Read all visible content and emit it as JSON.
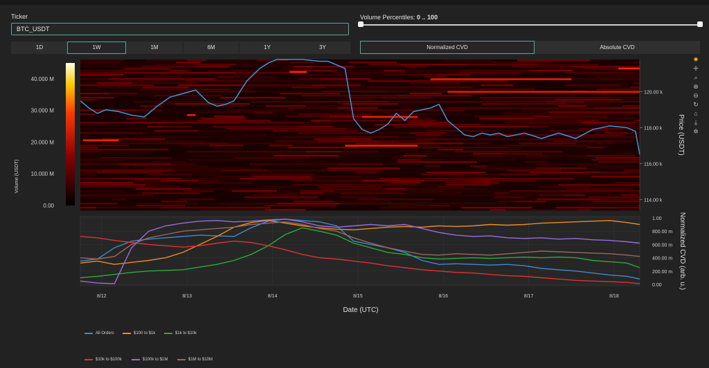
{
  "controls": {
    "ticker_label": "Ticker",
    "ticker_value": "BTC_USDT",
    "percentiles_label": "Volume Percentiles: ",
    "percentiles_value": "0 .. 100",
    "ranges": [
      {
        "label": "1D",
        "active": false
      },
      {
        "label": "1W",
        "active": true
      },
      {
        "label": "1M",
        "active": false
      },
      {
        "label": "6M",
        "active": false
      },
      {
        "label": "1Y",
        "active": false
      },
      {
        "label": "3Y",
        "active": false
      }
    ],
    "cvd_modes": [
      {
        "label": "Normalized CVD",
        "active": true
      },
      {
        "label": "Absolute CVD",
        "active": false
      }
    ]
  },
  "modebar_icons": [
    "plotly-logo-icon",
    "pan-icon",
    "zoom-icon",
    "zoom-in-icon",
    "zoom-out-icon",
    "autoscale-icon",
    "reset-icon",
    "download-icon",
    "spike-icon"
  ],
  "chart_data": [
    {
      "type": "heatmap",
      "title": "",
      "colorbar_title": "Volume (USDT)",
      "colorbar_ticks": [
        {
          "v": 0,
          "label": "0.00"
        },
        {
          "v": 10000000,
          "label": "10.000 M"
        },
        {
          "v": 20000000,
          "label": "20.000 M"
        },
        {
          "v": 30000000,
          "label": "30.000 M"
        },
        {
          "v": 40000000,
          "label": "40.000 M"
        }
      ],
      "colorbar_range": [
        0,
        45000000
      ],
      "ylabel": "Price (USDT)",
      "ylim": [
        113400,
        121800
      ],
      "yticks": [
        {
          "v": 114000,
          "label": "114.00 k"
        },
        {
          "v": 116000,
          "label": "116.00 k"
        },
        {
          "v": 118000,
          "label": "118.00 k"
        },
        {
          "v": 120000,
          "label": "120.00 k"
        }
      ],
      "xlim": [
        0,
        6.55
      ],
      "price_series": {
        "name": "Price",
        "color": "#3f8fd2",
        "x": [
          0,
          0.1,
          0.2,
          0.3,
          0.45,
          0.6,
          0.75,
          0.9,
          1.05,
          1.2,
          1.35,
          1.5,
          1.6,
          1.7,
          1.8,
          1.95,
          2.1,
          2.2,
          2.3,
          2.45,
          2.6,
          2.8,
          2.9,
          3.0,
          3.1,
          3.2,
          3.3,
          3.4,
          3.5,
          3.6,
          3.7,
          3.8,
          3.9,
          4.0,
          4.1,
          4.2,
          4.3,
          4.4,
          4.5,
          4.6,
          4.7,
          4.8,
          4.9,
          5.0,
          5.2,
          5.4,
          5.6,
          5.8,
          6.0,
          6.2,
          6.4,
          6.5,
          6.55
        ],
        "y": [
          119500,
          119100,
          118800,
          119000,
          118900,
          118700,
          118600,
          119200,
          119700,
          119900,
          120100,
          119400,
          119200,
          119300,
          119500,
          120600,
          121300,
          121600,
          121900,
          121800,
          121800,
          121700,
          121700,
          121500,
          121300,
          118500,
          117900,
          117700,
          117900,
          118200,
          118800,
          118400,
          118900,
          119000,
          119100,
          119300,
          118400,
          118000,
          117600,
          117500,
          117700,
          117600,
          117700,
          117500,
          117700,
          117400,
          117700,
          117400,
          117900,
          118100,
          118000,
          117800,
          116500
        ]
      },
      "bands": [
        {
          "y": 121300,
          "x0": 6.3,
          "x1": 6.55,
          "c": 0.9
        },
        {
          "y": 121100,
          "x0": 2.45,
          "x1": 2.65,
          "c": 0.95
        },
        {
          "y": 120700,
          "x0": 4.1,
          "x1": 5.75,
          "c": 0.75
        },
        {
          "y": 120000,
          "x0": 4.3,
          "x1": 6.55,
          "c": 0.7
        },
        {
          "y": 118700,
          "x0": 1.25,
          "x1": 1.35,
          "c": 0.8
        },
        {
          "y": 118600,
          "x0": 3.3,
          "x1": 3.95,
          "c": 0.75
        },
        {
          "y": 117300,
          "x0": 0.03,
          "x1": 0.45,
          "c": 0.85
        },
        {
          "y": 117000,
          "x0": 3.1,
          "x1": 3.95,
          "c": 0.85
        }
      ]
    },
    {
      "type": "line",
      "title": "",
      "xlabel": "Date (UTC)",
      "ylabel": "Normalized CVD (arb. u.)",
      "ylim": [
        -0.02,
        1.02
      ],
      "yticks": [
        {
          "v": 0,
          "label": "0.00"
        },
        {
          "v": 0.2,
          "label": "200.00 m"
        },
        {
          "v": 0.4,
          "label": "400.00 m"
        },
        {
          "v": 0.6,
          "label": "600.00 m"
        },
        {
          "v": 0.8,
          "label": "800.00 m"
        },
        {
          "v": 1,
          "label": "1.00"
        }
      ],
      "xlim": [
        0,
        6.55
      ],
      "xticks": [
        {
          "v": 0.25,
          "label": "8/12"
        },
        {
          "v": 1.25,
          "label": "8/13"
        },
        {
          "v": 2.25,
          "label": "8/14"
        },
        {
          "v": 3.25,
          "label": "8/15"
        },
        {
          "v": 4.25,
          "label": "8/16"
        },
        {
          "v": 5.25,
          "label": "8/17"
        },
        {
          "v": 6.25,
          "label": "8/18"
        }
      ],
      "series": [
        {
          "name": "All Orders",
          "color": "#3b8bd0",
          "x": [
            0,
            0.2,
            0.4,
            0.6,
            0.8,
            1.0,
            1.2,
            1.4,
            1.6,
            1.8,
            2.0,
            2.2,
            2.4,
            2.6,
            2.8,
            3.0,
            3.2,
            3.4,
            3.6,
            3.8,
            4.0,
            4.2,
            4.4,
            4.6,
            4.8,
            5.0,
            5.2,
            5.4,
            5.6,
            5.8,
            6.0,
            6.2,
            6.4,
            6.55
          ],
          "y": [
            0.35,
            0.38,
            0.55,
            0.65,
            0.68,
            0.7,
            0.72,
            0.74,
            0.73,
            0.72,
            0.85,
            0.95,
            0.98,
            0.96,
            0.94,
            0.88,
            0.65,
            0.6,
            0.55,
            0.48,
            0.36,
            0.3,
            0.31,
            0.3,
            0.29,
            0.3,
            0.28,
            0.24,
            0.22,
            0.2,
            0.17,
            0.14,
            0.12,
            0.08
          ]
        },
        {
          "name": "$100 to $1k",
          "color": "#f08a24",
          "x": [
            0,
            0.2,
            0.4,
            0.6,
            0.8,
            1.0,
            1.2,
            1.4,
            1.6,
            1.8,
            2.0,
            2.2,
            2.4,
            2.6,
            2.8,
            3.0,
            3.2,
            3.4,
            3.6,
            3.8,
            4.0,
            4.2,
            4.4,
            4.6,
            4.8,
            5.0,
            5.2,
            5.4,
            5.6,
            5.8,
            6.0,
            6.2,
            6.4,
            6.55
          ],
          "y": [
            0.32,
            0.35,
            0.3,
            0.33,
            0.36,
            0.4,
            0.48,
            0.6,
            0.72,
            0.86,
            0.93,
            0.96,
            0.92,
            0.88,
            0.85,
            0.83,
            0.82,
            0.84,
            0.86,
            0.87,
            0.86,
            0.88,
            0.87,
            0.88,
            0.9,
            0.89,
            0.9,
            0.92,
            0.93,
            0.94,
            0.95,
            0.96,
            0.93,
            0.9
          ]
        },
        {
          "name": "$1k to $10k",
          "color": "#2eaa3a",
          "x": [
            0,
            0.2,
            0.4,
            0.6,
            0.8,
            1.0,
            1.2,
            1.4,
            1.6,
            1.8,
            2.0,
            2.2,
            2.4,
            2.6,
            2.8,
            3.0,
            3.2,
            3.4,
            3.6,
            3.8,
            4.0,
            4.2,
            4.4,
            4.6,
            4.8,
            5.0,
            5.2,
            5.4,
            5.6,
            5.8,
            6.0,
            6.2,
            6.4,
            6.55
          ],
          "y": [
            0.1,
            0.12,
            0.15,
            0.18,
            0.2,
            0.21,
            0.22,
            0.26,
            0.3,
            0.36,
            0.45,
            0.58,
            0.75,
            0.85,
            0.8,
            0.74,
            0.62,
            0.55,
            0.48,
            0.45,
            0.4,
            0.38,
            0.39,
            0.4,
            0.39,
            0.4,
            0.41,
            0.4,
            0.41,
            0.4,
            0.36,
            0.34,
            0.32,
            0.25
          ]
        },
        {
          "name": "$10k to $100k",
          "color": "#e03131",
          "x": [
            0,
            0.2,
            0.4,
            0.6,
            0.8,
            1.0,
            1.2,
            1.4,
            1.6,
            1.8,
            2.0,
            2.2,
            2.4,
            2.6,
            2.8,
            3.0,
            3.2,
            3.4,
            3.6,
            3.8,
            4.0,
            4.2,
            4.4,
            4.6,
            4.8,
            5.0,
            5.2,
            5.4,
            5.6,
            5.8,
            6.0,
            6.2,
            6.4,
            6.55
          ],
          "y": [
            0.72,
            0.7,
            0.66,
            0.63,
            0.6,
            0.58,
            0.56,
            0.58,
            0.62,
            0.65,
            0.63,
            0.58,
            0.52,
            0.45,
            0.4,
            0.38,
            0.35,
            0.32,
            0.28,
            0.25,
            0.22,
            0.2,
            0.18,
            0.17,
            0.15,
            0.13,
            0.12,
            0.1,
            0.08,
            0.06,
            0.05,
            0.04,
            0.03,
            0.01
          ]
        },
        {
          "name": "$100k to $1M",
          "color": "#9b6be0",
          "x": [
            0,
            0.2,
            0.4,
            0.6,
            0.8,
            1.0,
            1.2,
            1.4,
            1.6,
            1.8,
            2.0,
            2.2,
            2.4,
            2.6,
            2.8,
            3.0,
            3.2,
            3.4,
            3.6,
            3.8,
            4.0,
            4.2,
            4.4,
            4.6,
            4.8,
            5.0,
            5.2,
            5.4,
            5.6,
            5.8,
            6.0,
            6.2,
            6.4,
            6.55
          ],
          "y": [
            0.05,
            0.02,
            0.01,
            0.55,
            0.8,
            0.88,
            0.92,
            0.95,
            0.96,
            0.94,
            0.95,
            0.97,
            0.98,
            0.94,
            0.88,
            0.86,
            0.88,
            0.9,
            0.88,
            0.9,
            0.84,
            0.78,
            0.74,
            0.72,
            0.73,
            0.7,
            0.69,
            0.7,
            0.68,
            0.69,
            0.67,
            0.66,
            0.64,
            0.62
          ]
        },
        {
          "name": "$1M to $10M",
          "color": "#9a6a58",
          "x": [
            0,
            0.2,
            0.4,
            0.6,
            0.8,
            1.0,
            1.2,
            1.4,
            1.6,
            1.8,
            2.0,
            2.2,
            2.4,
            2.6,
            2.8,
            3.0,
            3.2,
            3.4,
            3.6,
            3.8,
            4.0,
            4.2,
            4.4,
            4.6,
            4.8,
            5.0,
            5.2,
            5.4,
            5.6,
            5.8,
            6.0,
            6.2,
            6.4,
            6.55
          ],
          "y": [
            0.4,
            0.38,
            0.42,
            0.6,
            0.7,
            0.75,
            0.8,
            0.82,
            0.84,
            0.86,
            0.9,
            0.92,
            0.94,
            0.9,
            0.84,
            0.8,
            0.7,
            0.62,
            0.55,
            0.5,
            0.45,
            0.44,
            0.46,
            0.45,
            0.44,
            0.46,
            0.48,
            0.5,
            0.49,
            0.48,
            0.47,
            0.46,
            0.44,
            0.42
          ]
        }
      ]
    }
  ]
}
